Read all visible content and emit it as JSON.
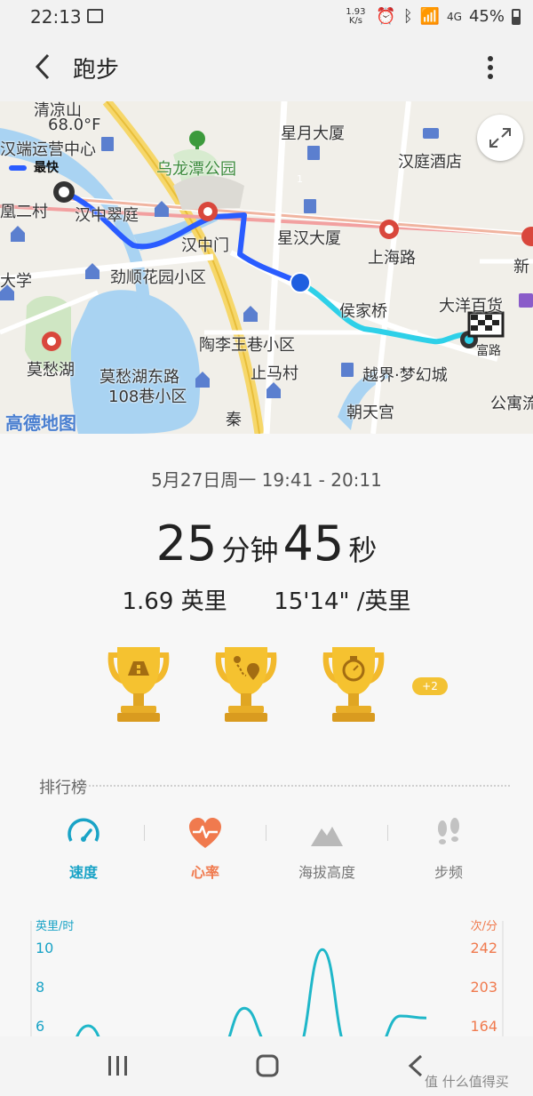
{
  "status_bar": {
    "time": "22:13",
    "net_speed": "1.93 K/s",
    "battery": "45%"
  },
  "header": {
    "title": "跑步"
  },
  "map": {
    "temperature": "68.0°F",
    "legend": "最快",
    "start_marker_label": "1",
    "attribution": "高德地图",
    "labels": {
      "l1": "清凉山",
      "l2": "汉端运营中心",
      "l3": "乌龙潭公园",
      "l4": "星月大厦",
      "l5": "汉庭酒店",
      "l6": "凰二村",
      "l7": "汉中翠庭",
      "l8": "汉中门",
      "l9": "星汉大厦",
      "l10": "上海路",
      "l11": "新",
      "l12": "大学",
      "l13": "劲顺花园小区",
      "l14": "侯家桥",
      "l15": "大洋百货",
      "l16": "莫愁湖",
      "l17": "陶李王巷小区",
      "l18": "莫愁湖东路",
      "l19": "108巷小区",
      "l20": "止马村",
      "l21": "越界·梦幻城",
      "l22": "朝天宫",
      "l23": "公寓流",
      "l24": "富路",
      "l25": "秦"
    }
  },
  "summary": {
    "date": "5月27日周一 19:41 - 20:11",
    "minutes": "25",
    "minutes_unit": "分钟",
    "seconds": "45",
    "seconds_unit": "秒",
    "distance": "1.69 英里",
    "pace": "15'14\" /英里",
    "extra_badges": "+2"
  },
  "ranking": {
    "title": "排行榜",
    "tabs": [
      "速度",
      "心率",
      "海拔高度",
      "步频"
    ]
  },
  "chart_data": {
    "type": "line",
    "ylabel_left": "英里/时",
    "ylabel_right": "次/分",
    "yticks_left": [
      "10",
      "8",
      "6"
    ],
    "yticks_right": [
      "242",
      "203",
      "164"
    ],
    "series": [
      {
        "color": "#1fb7c9",
        "values": [
          4.5,
          6.0,
          4.2,
          4.5,
          4.8,
          5.0,
          4.6,
          6.9,
          5.0,
          4.7,
          9.9,
          4.8,
          4.7,
          6.5,
          6.4
        ]
      }
    ]
  },
  "colors": {
    "accent_speed": "#19a3c6",
    "accent_heart": "#f07a4e",
    "route_fast": "#2a5cff",
    "route_slow": "#2ed0e8",
    "trophy_gold": "#f2b92c"
  },
  "navbar": {
    "watermark": "值 什么值得买"
  }
}
